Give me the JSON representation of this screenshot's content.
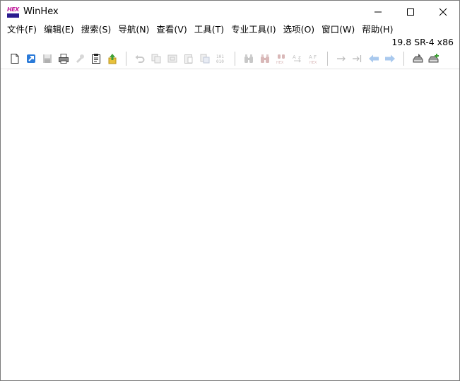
{
  "window": {
    "title": "WinHex",
    "icon_text": "HEX"
  },
  "controls": {
    "minimize": "minimize-icon",
    "maximize": "maximize-icon",
    "close": "close-icon"
  },
  "menu": [
    {
      "label": "文件(F)"
    },
    {
      "label": "编辑(E)"
    },
    {
      "label": "搜索(S)"
    },
    {
      "label": "导航(N)"
    },
    {
      "label": "查看(V)"
    },
    {
      "label": "工具(T)"
    },
    {
      "label": "专业工具(I)"
    },
    {
      "label": "选项(O)"
    },
    {
      "label": "窗口(W)"
    },
    {
      "label": "帮助(H)"
    }
  ],
  "version": "19.8 SR-4 x86",
  "toolbar": {
    "group1": [
      "new-file-icon",
      "open-icon",
      "save-icon",
      "print-icon",
      "properties-disabled-icon",
      "clipboard-icon",
      "export-icon"
    ],
    "group2": [
      "undo-icon",
      "copy-icon",
      "cut-icon",
      "paste-icon",
      "paste-special-icon",
      "binary-icon"
    ],
    "group3": [
      "find-text-icon",
      "find-hex-icon",
      "find-hex-alt-icon",
      "replace-text-icon",
      "replace-hex-icon"
    ],
    "group4": [
      "goto-offset-icon",
      "goto-sector-icon",
      "back-icon",
      "forward-icon"
    ],
    "group5": [
      "open-disk-icon",
      "add-disk-icon"
    ]
  },
  "colors": {
    "accent_blue": "#2a7ad8",
    "disabled_gray": "#c8c8c8",
    "export_green": "#3fa035",
    "export_yellow": "#e8c23c"
  }
}
